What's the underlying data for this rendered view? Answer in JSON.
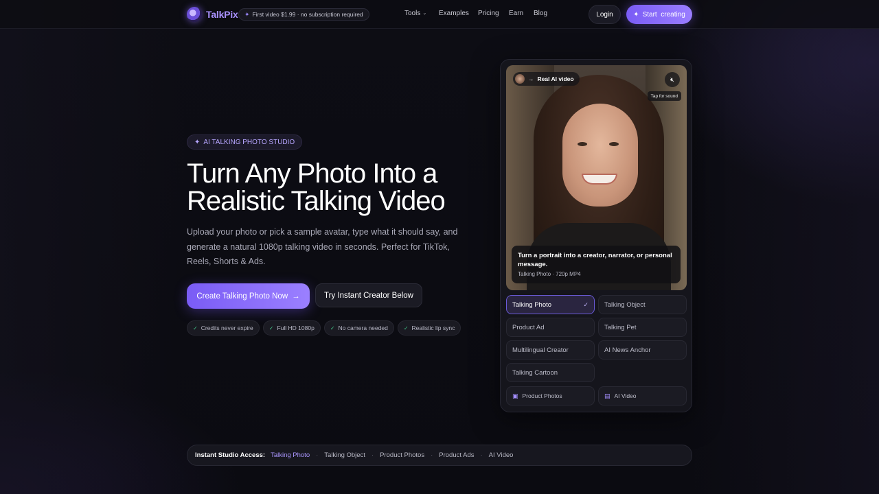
{
  "brand": {
    "name": "TalkPix"
  },
  "promo": {
    "text": "First video $1.99 · no subscription required"
  },
  "nav": {
    "tools": "Tools",
    "examples": "Examples",
    "pricing": "Pricing",
    "earn": "Earn",
    "blog": "Blog"
  },
  "header": {
    "login": "Login",
    "start": "Start  creating"
  },
  "hero": {
    "badge": "AI TALKING PHOTO STUDIO",
    "title_line1": "Turn Any Photo Into a",
    "title_line2": "Realistic Talking Video",
    "subtitle": "Upload your photo or pick a sample avatar, type what it should say, and generate a natural 1080p talking video in seconds. Perfect for TikTok, Reels, Shorts & Ads.",
    "cta_primary": "Create Talking Photo Now",
    "cta_secondary": "Try Instant Creator Below",
    "features": [
      "Credits never expire",
      "Full HD 1080p",
      "No camera needed",
      "Realistic lip sync"
    ]
  },
  "card": {
    "video_tag": "Real AI video",
    "tap_sound": "Tap for sound",
    "caption_title": "Turn a portrait into a creator, narrator, or personal message.",
    "caption_meta": "Talking Photo · 720p MP4",
    "options": [
      "Talking Photo",
      "Talking Object",
      "Product Ad",
      "Talking Pet",
      "Multilingual Creator",
      "AI News Anchor",
      "Talking Cartoon"
    ],
    "selected_option": "Talking Photo",
    "extras": [
      "Product Photos",
      "AI Video"
    ]
  },
  "access_bar": {
    "label": "Instant Studio Access:",
    "links": [
      "Talking Photo",
      "Talking Object",
      "Product Photos",
      "Product Ads",
      "AI Video"
    ]
  },
  "colors": {
    "accent": "#8a6dfc",
    "background": "#0c0c12",
    "check": "#42c98a"
  }
}
